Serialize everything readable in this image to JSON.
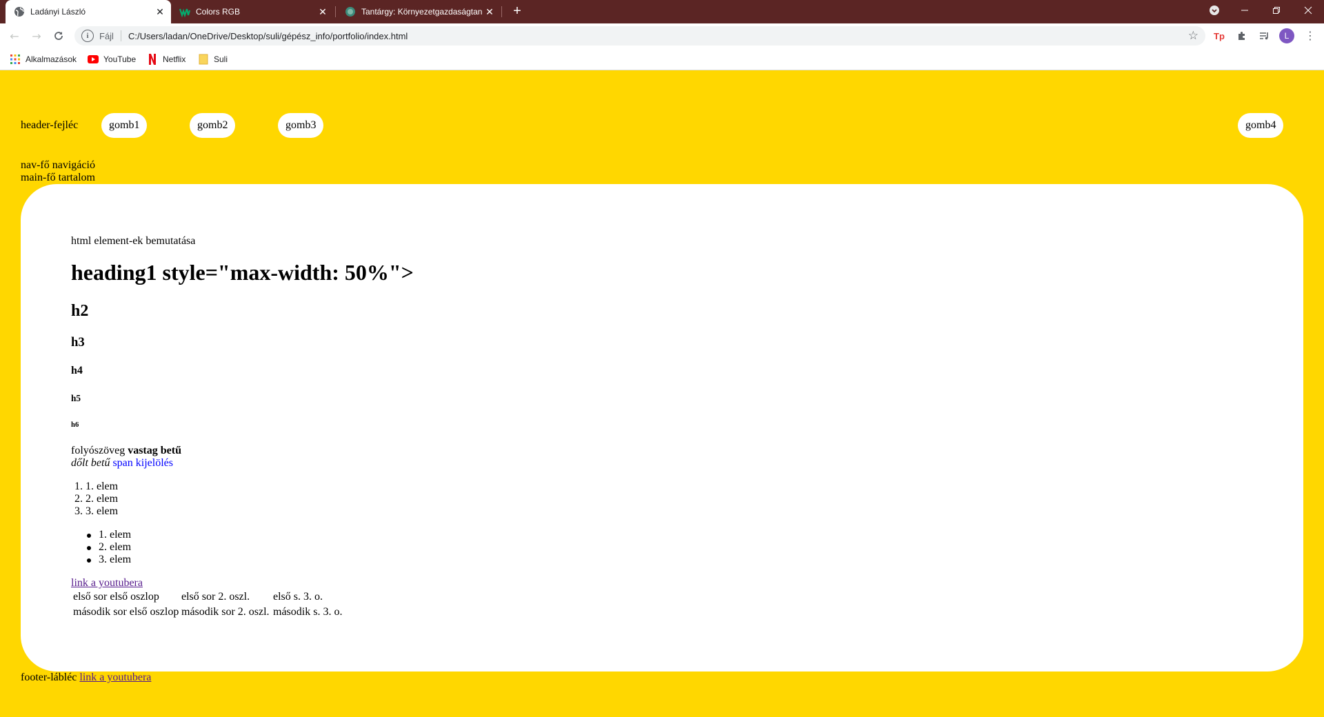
{
  "browser": {
    "tabs": [
      {
        "title": "Ladányi László",
        "active": true
      },
      {
        "title": "Colors RGB",
        "active": false
      },
      {
        "title": "Tantárgy: Környezetgazdaságtan",
        "active": false
      }
    ],
    "new_tab": "+",
    "address": {
      "scheme": "Fájl",
      "url": "C:/Users/ladan/OneDrive/Desktop/suli/gépész_info/portfolio/index.html"
    },
    "avatar_letter": "L",
    "ext_tp": "Tp",
    "bookmarks": [
      {
        "label": "Alkalmazások",
        "icon": "apps-grid-icon"
      },
      {
        "label": "YouTube",
        "icon": "youtube-icon"
      },
      {
        "label": "Netflix",
        "icon": "netflix-icon"
      },
      {
        "label": "Suli",
        "icon": "folder-icon"
      }
    ],
    "colors": {
      "tabstrip": "#5b2524",
      "page_bg": "#ffd700"
    }
  },
  "page": {
    "header_label": "header-fejléc",
    "buttons": [
      "gomb1",
      "gomb2",
      "gomb3",
      "gomb4"
    ],
    "nav_label": "nav-fő navigáció",
    "main_label": "main-fő tartalom",
    "main": {
      "intro": "html element-ek bemutatása",
      "h1": "heading1 style=\"max-width: 50%\">",
      "h2": "h2",
      "h3": "h3",
      "h4": "h4",
      "h5": "h5",
      "h6": "h6",
      "paragraph": {
        "text": "folyószöveg",
        "bold": "vastag betű",
        "italic": "dőlt betű",
        "span": "span kijelölés"
      },
      "ordered_list": [
        {
          "marker": "1.",
          "text": "1. elem"
        },
        {
          "marker": "2.",
          "text": "2. elem"
        },
        {
          "marker": "3.",
          "text": "3. elem"
        }
      ],
      "unordered_list": [
        "1. elem",
        "2. elem",
        "3. elem"
      ],
      "link": "link a youtubera",
      "table": [
        [
          "első sor első oszlop",
          "első sor 2. oszl.",
          "első s. 3. o."
        ],
        [
          "második sor első oszlop",
          "második sor 2. oszl.",
          "második s. 3. o."
        ]
      ]
    },
    "footer": {
      "label": "footer-lábléc",
      "link": "link a youtubera"
    }
  }
}
